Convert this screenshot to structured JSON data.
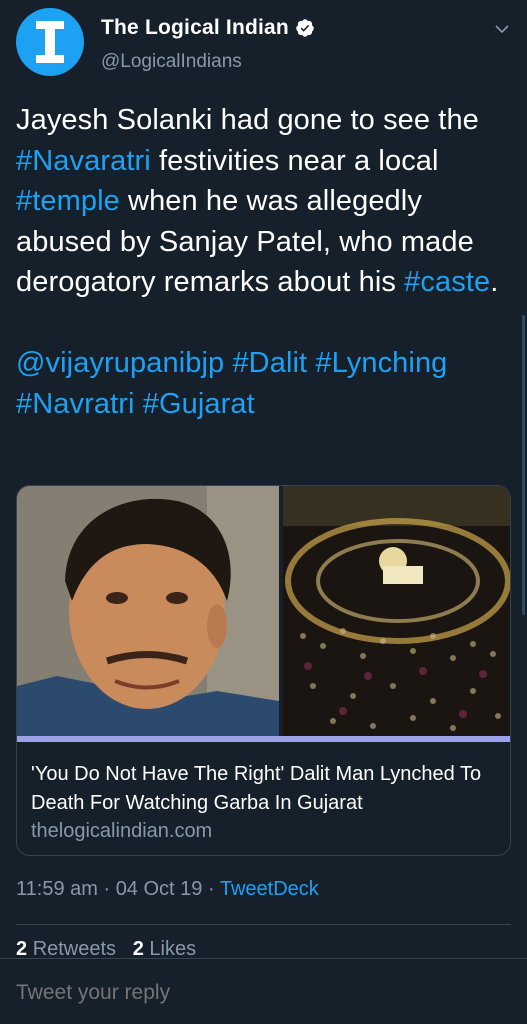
{
  "account": {
    "name": "The Logical Indian",
    "handle": "@LogicalIndians"
  },
  "tweet": {
    "segments_p1": [
      {
        "text": "Jayesh Solanki had gone to see the ",
        "link": false
      },
      {
        "text": "#Navaratri",
        "link": true
      },
      {
        "text": " festivities near a local ",
        "link": false
      },
      {
        "text": "#temple",
        "link": true
      },
      {
        "text": " when he was allegedly abused by Sanjay Patel, who made derogatory remarks about his ",
        "link": false
      },
      {
        "text": "#caste",
        "link": true
      },
      {
        "text": ".",
        "link": false
      }
    ],
    "segments_p2": [
      {
        "text": "@vijayrupanibjp",
        "link": true
      },
      {
        "text": " ",
        "link": false
      },
      {
        "text": "#Dalit",
        "link": true
      },
      {
        "text": " ",
        "link": false
      },
      {
        "text": "#Lynching",
        "link": true
      },
      {
        "text": " ",
        "link": false
      },
      {
        "text": "#Navratri",
        "link": true
      },
      {
        "text": " ",
        "link": false
      },
      {
        "text": "#Gujarat",
        "link": true
      }
    ]
  },
  "card": {
    "title": "'You Do Not Have The Right' Dalit Man Lynched To Death For Watching Garba In Gujarat",
    "domain": "thelogicalindian.com"
  },
  "meta": {
    "time": "11:59 am",
    "sep1": " · ",
    "date": "04 Oct 19",
    "sep2": " · ",
    "source": "TweetDeck"
  },
  "stats": {
    "retweets_count": "2",
    "retweets_label": "Retweets",
    "likes_count": "2",
    "likes_label": "Likes"
  },
  "reply": {
    "placeholder": "Tweet your reply"
  },
  "colors": {
    "background": "#15202b",
    "accent": "#1da1f2",
    "secondary_text": "#8899a6",
    "border": "#38444d"
  },
  "icons": [
    "logo-avatar",
    "verified-badge-icon",
    "chevron-down-icon"
  ]
}
